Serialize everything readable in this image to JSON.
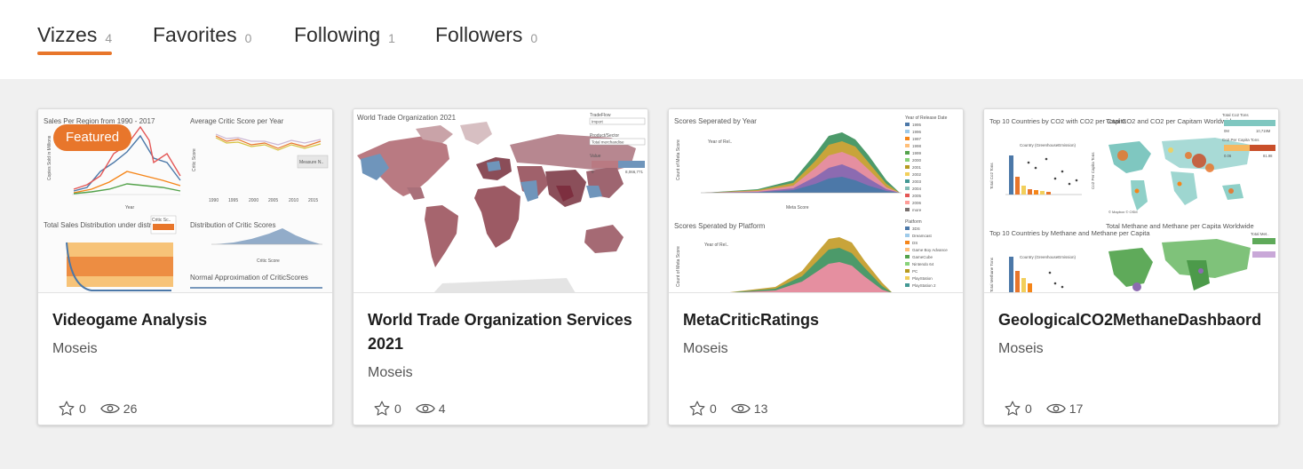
{
  "tabs": [
    {
      "label": "Vizzes",
      "count": "4"
    },
    {
      "label": "Favorites",
      "count": "0"
    },
    {
      "label": "Following",
      "count": "1"
    },
    {
      "label": "Followers",
      "count": "0"
    }
  ],
  "cards": [
    {
      "title": "Videogame Analysis",
      "author": "Moseis",
      "favorites": "0",
      "views": "26",
      "badge": "Featured",
      "thumb": {
        "t1": "Sales Per Region from 1990 - 2017",
        "t2": "Average Critic Score per Year",
        "t3": "Total Sales Distribution under distribution",
        "t4": "Distribution of Critic Scores",
        "t5": "Normal Approximation of CriticScores",
        "legend": "Critic Sc..",
        "measure": "Measure N..",
        "ylab1": "Copies Sold in Millions",
        "ylab2": "Critic Score",
        "xlab": "Year",
        "xlab2": "Critic Score",
        "years": [
          "1990",
          "1995",
          "2000",
          "2005",
          "2010",
          "2015"
        ]
      }
    },
    {
      "title": "World Trade Organization Services 2021",
      "author": "Moseis",
      "favorites": "0",
      "views": "4",
      "thumb": {
        "t1": "World Trade Organization 2021",
        "f1": "TradeFlow",
        "f1v": "Import",
        "f2": "Product/Sector",
        "f2v": "Total merchandise",
        "f3": "Value",
        "min": "0",
        "max": "8,066,771"
      }
    },
    {
      "title": "MetaCriticRatings",
      "author": "Moseis",
      "favorites": "0",
      "views": "13",
      "thumb": {
        "t1": "Scores Seperated by Year",
        "t2": "Scores Sperated by Platform",
        "ylab": "Count of Meta Score",
        "xlab": "Meta Score",
        "selector": "Year of Rel..",
        "legend1_title": "Year of Release Date",
        "legend1": [
          "1995",
          "1996",
          "1997",
          "1998",
          "1999",
          "2000",
          "2001",
          "2002",
          "2003",
          "2004",
          "2005",
          "2006",
          "more"
        ],
        "legend2_title": "Platform",
        "legend2": [
          "3DS",
          "Dreamcast",
          "DS",
          "Game Boy Advance",
          "GameCube",
          "Nintendo 64",
          "PC",
          "PlayStation",
          "PlayStation 2"
        ]
      }
    },
    {
      "title": "GeologicalCO2MethaneDashbaord",
      "author": "Moseis",
      "favorites": "0",
      "views": "17",
      "thumb": {
        "t1": "Top 10 Countries by CO2 with CO2 per Capita",
        "t2": "Total CO2 and CO2 per Capitam Worldwide",
        "t3": "Top 10 Countries by Methane and Methane per Capita",
        "t4": "Total Methane and Methane per Capita Worldwide",
        "l1": "Total Co2 Tons",
        "l1a": "0M",
        "l1b": "10,719M",
        "l2": "Co2 Per Capita Tons",
        "l2a": "0.06",
        "l2b": "81.98",
        "l3": "Total Met..",
        "group": "Country (GreenhouseEmission)",
        "y1": "Total Co2 Tons",
        "y2": "Co2 Per Capita Tons",
        "y3": "Total Methane Tons",
        "credit": "© Mapbox © OSM"
      }
    }
  ]
}
